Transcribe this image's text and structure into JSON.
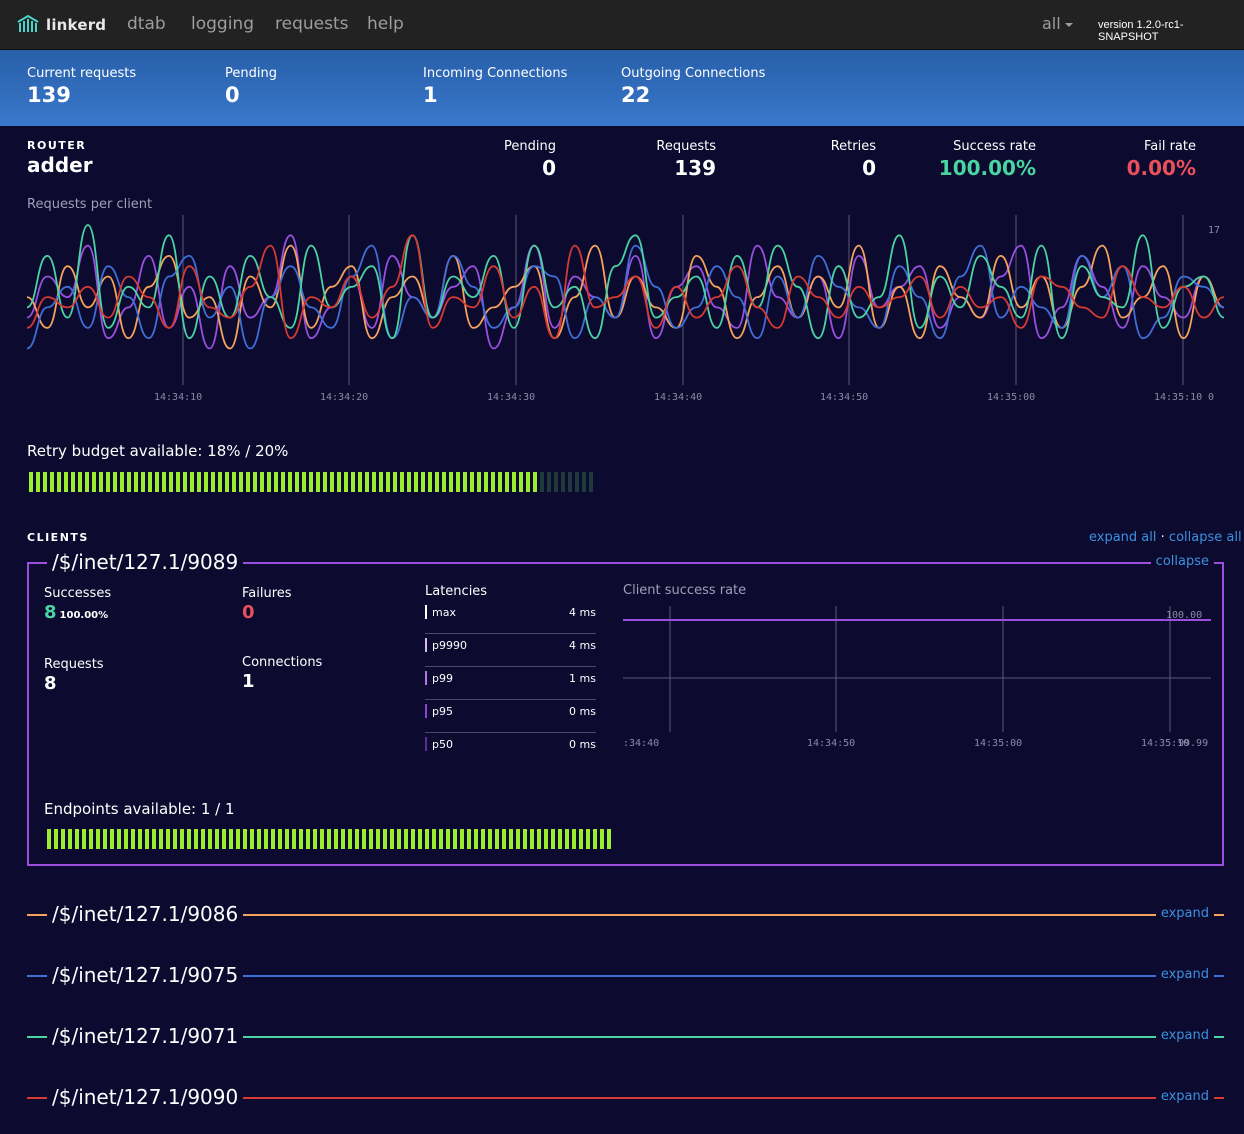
{
  "nav": {
    "brand": "linkerd",
    "links": [
      "dtab",
      "logging",
      "requests",
      "help"
    ],
    "router_select": "all",
    "version": "version 1.2.0-rc1-SNAPSHOT"
  },
  "summary": [
    {
      "label": "Current requests",
      "value": "139"
    },
    {
      "label": "Pending",
      "value": "0"
    },
    {
      "label": "Incoming Connections",
      "value": "1"
    },
    {
      "label": "Outgoing Connections",
      "value": "22"
    }
  ],
  "router": {
    "label": "ROUTER",
    "name": "adder",
    "stats": [
      {
        "label": "Pending",
        "value": "0"
      },
      {
        "label": "Requests",
        "value": "139"
      },
      {
        "label": "Retries",
        "value": "0"
      },
      {
        "label": "Success rate",
        "value": "100.00%"
      },
      {
        "label": "Fail rate",
        "value": "0.00%"
      }
    ]
  },
  "colors": {
    "purple": "#9b4fe0",
    "orange": "#f5a35c",
    "blue": "#3f6fd6",
    "teal": "#4ad4a2",
    "red": "#d63a32",
    "bar_green": "#9bee2f",
    "bar_dim": "#1f3a3a",
    "link": "#3c90e0"
  },
  "chart_data": [
    {
      "type": "line",
      "title": "Requests per client",
      "x_ticks": [
        "14:34:10",
        "14:34:20",
        "14:34:30",
        "14:34:40",
        "14:34:50",
        "14:35:00",
        "14:35:10"
      ],
      "ylim": [
        0,
        17
      ],
      "y_ticks": [
        "17",
        "0"
      ],
      "series": [
        {
          "values": [
            8,
            12,
            10,
            15,
            6,
            9,
            14,
            7,
            11,
            5,
            13,
            8,
            10,
            16,
            6,
            9,
            12,
            7,
            14,
            10,
            8,
            11,
            13,
            5,
            9,
            15,
            7,
            12,
            10,
            8,
            14,
            6,
            11,
            13,
            9,
            7,
            15,
            10,
            8,
            12,
            6,
            14,
            9,
            11,
            13,
            7,
            10,
            8,
            12,
            15,
            6,
            9,
            14,
            11,
            7,
            13,
            10,
            8,
            12,
            9
          ]
        },
        {
          "values": [
            10,
            7,
            13,
            9,
            12,
            6,
            11,
            14,
            8,
            10,
            5,
            12,
            9,
            15,
            7,
            11,
            13,
            6,
            10,
            12,
            8,
            14,
            7,
            9,
            11,
            13,
            6,
            10,
            15,
            8,
            12,
            9,
            7,
            14,
            11,
            6,
            10,
            13,
            8,
            12,
            9,
            15,
            7,
            11,
            6,
            13,
            10,
            8,
            14,
            9,
            12,
            7,
            11,
            15,
            8,
            10,
            13,
            6,
            12,
            9
          ]
        },
        {
          "values": [
            5,
            9,
            11,
            7,
            13,
            10,
            6,
            12,
            14,
            8,
            11,
            5,
            10,
            13,
            9,
            7,
            12,
            15,
            6,
            10,
            8,
            14,
            11,
            7,
            9,
            13,
            12,
            6,
            10,
            8,
            15,
            11,
            7,
            9,
            13,
            10,
            6,
            12,
            8,
            14,
            11,
            9,
            7,
            13,
            10,
            6,
            12,
            15,
            8,
            11,
            9,
            7,
            14,
            10,
            13,
            6,
            8,
            12,
            11,
            9
          ]
        },
        {
          "values": [
            9,
            14,
            8,
            17,
            7,
            11,
            9,
            16,
            6,
            12,
            8,
            14,
            10,
            7,
            15,
            9,
            11,
            13,
            6,
            16,
            8,
            12,
            10,
            14,
            7,
            15,
            9,
            11,
            6,
            13,
            16,
            8,
            10,
            12,
            7,
            14,
            9,
            15,
            11,
            6,
            13,
            8,
            10,
            16,
            7,
            12,
            9,
            14,
            11,
            8,
            15,
            6,
            13,
            10,
            9,
            16,
            7,
            11,
            12,
            8
          ]
        },
        {
          "values": [
            7,
            10,
            9,
            11,
            8,
            12,
            10,
            7,
            13,
            9,
            8,
            11,
            15,
            6,
            10,
            9,
            12,
            8,
            11,
            16,
            7,
            10,
            9,
            13,
            8,
            11,
            6,
            15,
            9,
            10,
            12,
            7,
            11,
            8,
            10,
            13,
            9,
            7,
            12,
            10,
            8,
            11,
            9,
            10,
            12,
            8,
            11,
            9,
            10,
            7,
            12,
            11,
            9,
            8,
            13,
            10,
            9,
            11,
            8,
            10
          ]
        }
      ]
    },
    {
      "type": "line",
      "title": "Client success rate",
      "x_ticks": [
        ":34:40",
        "14:34:50",
        "14:35:00",
        "14:35:10"
      ],
      "ylim": [
        99.99,
        100.0
      ],
      "y_ticks": [
        "100.00",
        "99.99"
      ],
      "series": [
        {
          "values": [
            100.0,
            100.0,
            100.0,
            100.0,
            100.0,
            100.0,
            100.0,
            100.0,
            100.0,
            100.0
          ]
        }
      ]
    }
  ],
  "retry_budget": {
    "label": "Retry budget available: 18% / 20%",
    "available": 18,
    "total": 20
  },
  "clients_section": {
    "label": "CLIENTS",
    "expand_all": "expand all",
    "separator": "·",
    "collapse_all": "collapse all"
  },
  "expanded_client": {
    "name": "/$/inet/127.1/9089",
    "toggle": "collapse",
    "successes_label": "Successes",
    "successes": "8",
    "success_pct": "100.00%",
    "failures_label": "Failures",
    "failures": "0",
    "requests_label": "Requests",
    "requests": "8",
    "connections_label": "Connections",
    "connections": "1",
    "latencies_label": "Latencies",
    "latencies": [
      {
        "name": "max",
        "value": "4 ms"
      },
      {
        "name": "p9990",
        "value": "4 ms"
      },
      {
        "name": "p99",
        "value": "1 ms"
      },
      {
        "name": "p95",
        "value": "0 ms"
      },
      {
        "name": "p50",
        "value": "0 ms"
      }
    ],
    "endpoints": {
      "label": "Endpoints available: 1 / 1",
      "available": 1,
      "total": 1
    }
  },
  "collapsed_clients": [
    {
      "name": "/$/inet/127.1/9086",
      "toggle": "expand",
      "color": "#f5a35c"
    },
    {
      "name": "/$/inet/127.1/9075",
      "toggle": "expand",
      "color": "#3f6fd6"
    },
    {
      "name": "/$/inet/127.1/9071",
      "toggle": "expand",
      "color": "#4ad4a2"
    },
    {
      "name": "/$/inet/127.1/9090",
      "toggle": "expand",
      "color": "#d63a32"
    }
  ]
}
